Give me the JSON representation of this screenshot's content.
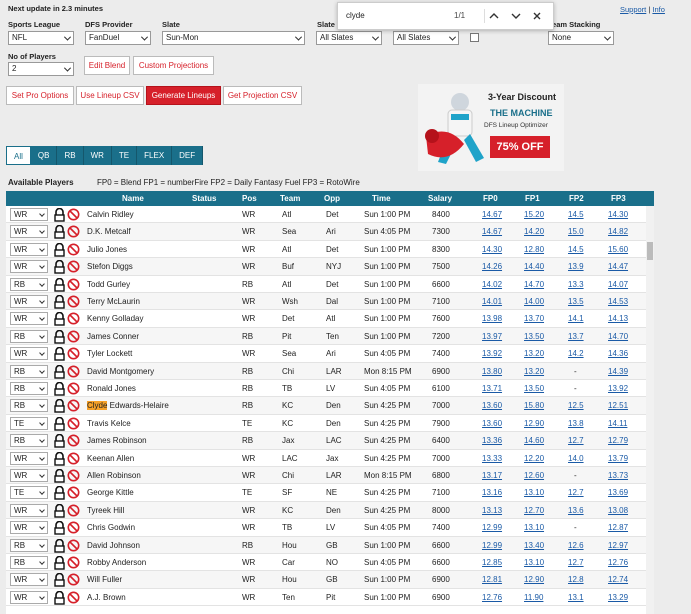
{
  "update_note": "Next update in 2.3 minutes",
  "links": {
    "support": "Support",
    "sep": "|",
    "info": "Info"
  },
  "find_bar": {
    "query": "clyde",
    "count": "1/1"
  },
  "controls": {
    "sports_league": {
      "label": "Sports League",
      "value": "NFL"
    },
    "dfs_provider": {
      "label": "DFS Provider",
      "value": "FanDuel"
    },
    "slate": {
      "label": "Slate",
      "value": "Sun-Mon"
    },
    "slate2": {
      "label": "Slate",
      "value": "All Slates"
    },
    "slate3": {
      "value": "All Slates"
    },
    "team_stacking": {
      "label": "Team Stacking",
      "value": "None"
    },
    "no_players": {
      "label": "No of Players",
      "value": "2"
    }
  },
  "buttons": {
    "edit_blend": "Edit Blend",
    "custom_projections": "Custom Projections",
    "set_pro_options": "Set Pro Options",
    "use_lineup_csv": "Use Lineup CSV",
    "generate_lineups": "Generate Lineups",
    "get_projection_csv": "Get Projection CSV"
  },
  "ad": {
    "line1": "3-Year Discount",
    "line2": "THE MACHINE",
    "line3": "DFS Lineup Optimizer",
    "badge": "75% OFF"
  },
  "tabs": [
    "All",
    "QB",
    "RB",
    "WR",
    "TE",
    "FLEX",
    "DEF"
  ],
  "section": {
    "title": "Available Players",
    "legend": "FP0 = Blend  FP1 = numberFire  FP2 = Daily Fantasy Fuel  FP3 = RotoWire"
  },
  "columns": [
    "Name",
    "Status",
    "Pos",
    "Team",
    "Opp",
    "Time",
    "Salary",
    "FP0",
    "FP1",
    "FP2",
    "FP3"
  ],
  "colors": {
    "accent": "#1a6f8a",
    "button_red": "#d6202a",
    "highlight": "#f7a128"
  },
  "players": [
    {
      "sel": "WR",
      "name": "Calvin Ridley",
      "pos": "WR",
      "team": "Atl",
      "opp": "Det",
      "time": "Sun 1:00 PM",
      "salary": "8400",
      "fp0": "14.67",
      "fp1": "15.20",
      "fp2": "14.5",
      "fp3": "14.30"
    },
    {
      "sel": "WR",
      "name": "D.K. Metcalf",
      "pos": "WR",
      "team": "Sea",
      "opp": "Ari",
      "time": "Sun 4:05 PM",
      "salary": "7300",
      "fp0": "14.67",
      "fp1": "14.20",
      "fp2": "15.0",
      "fp3": "14.82"
    },
    {
      "sel": "WR",
      "name": "Julio Jones",
      "pos": "WR",
      "team": "Atl",
      "opp": "Det",
      "time": "Sun 1:00 PM",
      "salary": "8300",
      "fp0": "14.30",
      "fp1": "12.80",
      "fp2": "14.5",
      "fp3": "15.60"
    },
    {
      "sel": "WR",
      "name": "Stefon Diggs",
      "pos": "WR",
      "team": "Buf",
      "opp": "NYJ",
      "time": "Sun 1:00 PM",
      "salary": "7500",
      "fp0": "14.26",
      "fp1": "14.40",
      "fp2": "13.9",
      "fp3": "14.47"
    },
    {
      "sel": "RB",
      "name": "Todd Gurley",
      "pos": "RB",
      "team": "Atl",
      "opp": "Det",
      "time": "Sun 1:00 PM",
      "salary": "6600",
      "fp0": "14.02",
      "fp1": "14.70",
      "fp2": "13.3",
      "fp3": "14.07"
    },
    {
      "sel": "WR",
      "name": "Terry McLaurin",
      "pos": "WR",
      "team": "Wsh",
      "opp": "Dal",
      "time": "Sun 1:00 PM",
      "salary": "7100",
      "fp0": "14.01",
      "fp1": "14.00",
      "fp2": "13.5",
      "fp3": "14.53"
    },
    {
      "sel": "WR",
      "name": "Kenny Golladay",
      "pos": "WR",
      "team": "Det",
      "opp": "Atl",
      "time": "Sun 1:00 PM",
      "salary": "7600",
      "fp0": "13.98",
      "fp1": "13.70",
      "fp2": "14.1",
      "fp3": "14.13"
    },
    {
      "sel": "RB",
      "name": "James Conner",
      "pos": "RB",
      "team": "Pit",
      "opp": "Ten",
      "time": "Sun 1:00 PM",
      "salary": "7200",
      "fp0": "13.97",
      "fp1": "13.50",
      "fp2": "13.7",
      "fp3": "14.70"
    },
    {
      "sel": "WR",
      "name": "Tyler Lockett",
      "pos": "WR",
      "team": "Sea",
      "opp": "Ari",
      "time": "Sun 4:05 PM",
      "salary": "7400",
      "fp0": "13.92",
      "fp1": "13.20",
      "fp2": "14.2",
      "fp3": "14.36"
    },
    {
      "sel": "RB",
      "name": "David Montgomery",
      "pos": "RB",
      "team": "Chi",
      "opp": "LAR",
      "time": "Mon 8:15 PM",
      "salary": "6900",
      "fp0": "13.80",
      "fp1": "13.20",
      "fp2": "-",
      "fp3": "14.39"
    },
    {
      "sel": "RB",
      "name": "Ronald Jones",
      "pos": "RB",
      "team": "TB",
      "opp": "LV",
      "time": "Sun 4:05 PM",
      "salary": "6100",
      "fp0": "13.71",
      "fp1": "13.50",
      "fp2": "-",
      "fp3": "13.92"
    },
    {
      "sel": "RB",
      "name_hl": "Clyde",
      "name": " Edwards-Helaire",
      "pos": "RB",
      "team": "KC",
      "opp": "Den",
      "time": "Sun 4:25 PM",
      "salary": "7000",
      "fp0": "13.60",
      "fp1": "15.80",
      "fp2": "12.5",
      "fp3": "12.51"
    },
    {
      "sel": "TE",
      "name": "Travis Kelce",
      "pos": "TE",
      "team": "KC",
      "opp": "Den",
      "time": "Sun 4:25 PM",
      "salary": "7900",
      "fp0": "13.60",
      "fp1": "12.90",
      "fp2": "13.8",
      "fp3": "14.11"
    },
    {
      "sel": "RB",
      "name": "James Robinson",
      "pos": "RB",
      "team": "Jax",
      "opp": "LAC",
      "time": "Sun 4:25 PM",
      "salary": "6400",
      "fp0": "13.36",
      "fp1": "14.60",
      "fp2": "12.7",
      "fp3": "12.79"
    },
    {
      "sel": "WR",
      "name": "Keenan Allen",
      "pos": "WR",
      "team": "LAC",
      "opp": "Jax",
      "time": "Sun 4:25 PM",
      "salary": "7000",
      "fp0": "13.33",
      "fp1": "12.20",
      "fp2": "14.0",
      "fp3": "13.79"
    },
    {
      "sel": "WR",
      "name": "Allen Robinson",
      "pos": "WR",
      "team": "Chi",
      "opp": "LAR",
      "time": "Mon 8:15 PM",
      "salary": "6800",
      "fp0": "13.17",
      "fp1": "12.60",
      "fp2": "-",
      "fp3": "13.73"
    },
    {
      "sel": "TE",
      "name": "George Kittle",
      "pos": "TE",
      "team": "SF",
      "opp": "NE",
      "time": "Sun 4:25 PM",
      "salary": "7100",
      "fp0": "13.16",
      "fp1": "13.10",
      "fp2": "12.7",
      "fp3": "13.69"
    },
    {
      "sel": "WR",
      "name": "Tyreek Hill",
      "pos": "WR",
      "team": "KC",
      "opp": "Den",
      "time": "Sun 4:25 PM",
      "salary": "8000",
      "fp0": "13.13",
      "fp1": "12.70",
      "fp2": "13.6",
      "fp3": "13.08"
    },
    {
      "sel": "WR",
      "name": "Chris Godwin",
      "pos": "WR",
      "team": "TB",
      "opp": "LV",
      "time": "Sun 4:05 PM",
      "salary": "7400",
      "fp0": "12.99",
      "fp1": "13.10",
      "fp2": "-",
      "fp3": "12.87"
    },
    {
      "sel": "RB",
      "name": "David Johnson",
      "pos": "RB",
      "team": "Hou",
      "opp": "GB",
      "time": "Sun 1:00 PM",
      "salary": "6600",
      "fp0": "12.99",
      "fp1": "13.40",
      "fp2": "12.6",
      "fp3": "12.97"
    },
    {
      "sel": "RB",
      "name": "Robby Anderson",
      "pos": "WR",
      "team": "Car",
      "opp": "NO",
      "time": "Sun 4:05 PM",
      "salary": "6600",
      "fp0": "12.85",
      "fp1": "13.10",
      "fp2": "12.7",
      "fp3": "12.76"
    },
    {
      "sel": "WR",
      "name": "Will Fuller",
      "pos": "WR",
      "team": "Hou",
      "opp": "GB",
      "time": "Sun 1:00 PM",
      "salary": "6900",
      "fp0": "12.81",
      "fp1": "12.90",
      "fp2": "12.8",
      "fp3": "12.74"
    },
    {
      "sel": "WR",
      "name": "A.J. Brown",
      "pos": "WR",
      "team": "Ten",
      "opp": "Pit",
      "time": "Sun 1:00 PM",
      "salary": "6900",
      "fp0": "12.76",
      "fp1": "11.90",
      "fp2": "13.1",
      "fp3": "13.29"
    }
  ]
}
